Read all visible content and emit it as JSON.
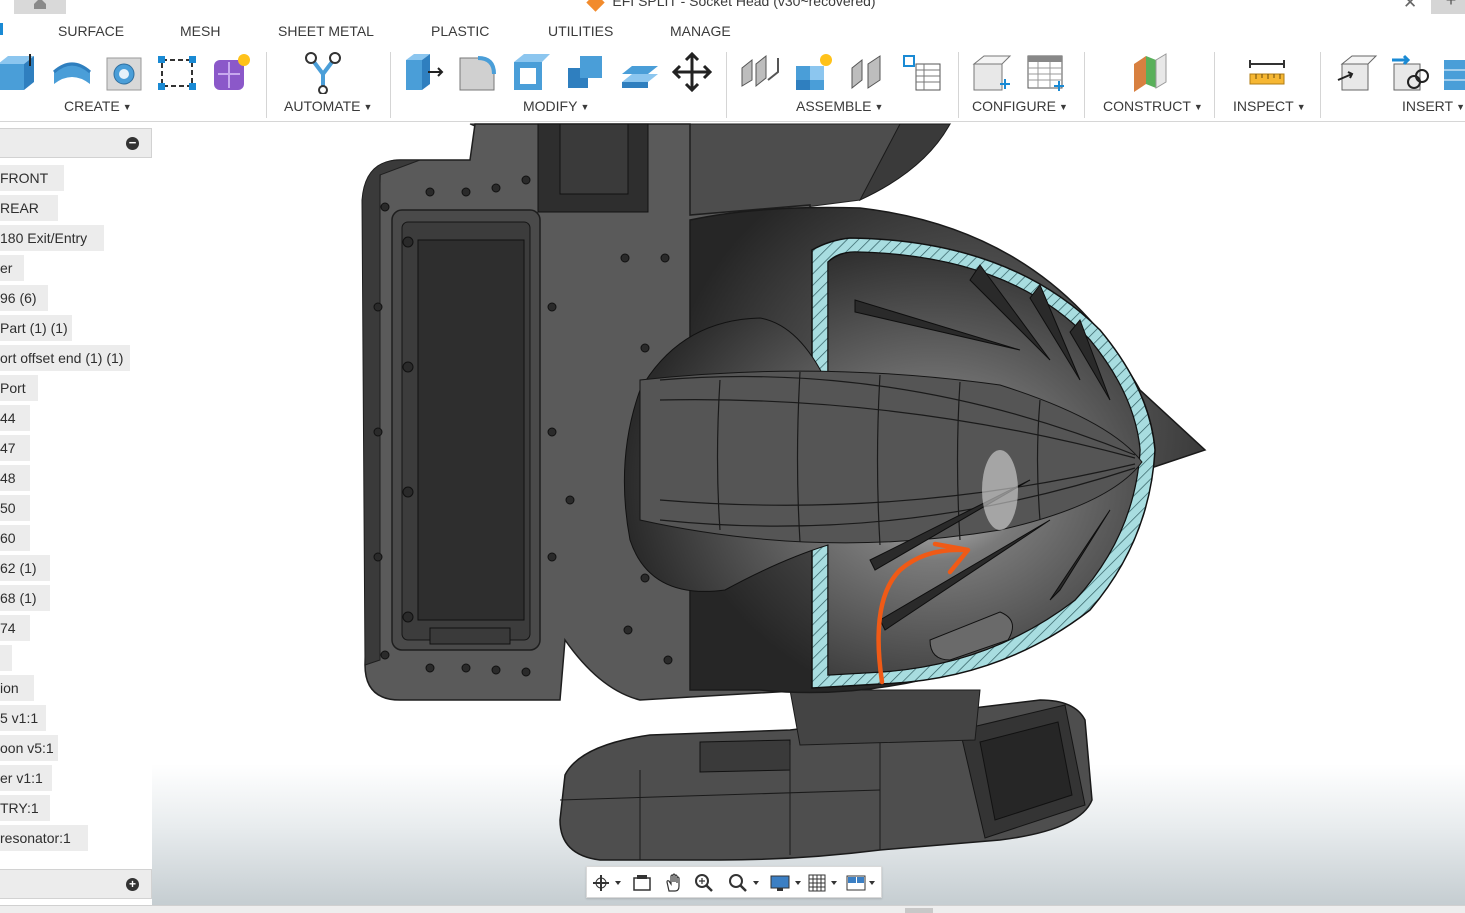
{
  "window": {
    "title": "EFI SPLIT - Socket Head (v30~recovered)"
  },
  "tabs": [
    {
      "label": "SURFACE"
    },
    {
      "label": "MESH"
    },
    {
      "label": "SHEET METAL"
    },
    {
      "label": "PLASTIC"
    },
    {
      "label": "UTILITIES"
    },
    {
      "label": "MANAGE"
    }
  ],
  "ribbon": {
    "groups": [
      {
        "label": "CREATE",
        "icons": [
          "extrude-icon",
          "sweep-icon",
          "hole-icon",
          "sketch-icon",
          "create-form-icon"
        ]
      },
      {
        "label": "AUTOMATE",
        "icons": [
          "automate-icon"
        ]
      },
      {
        "label": "MODIFY",
        "icons": [
          "press-pull-icon",
          "fillet-icon",
          "shell-icon",
          "combine-icon",
          "offset-face-icon",
          "move-icon"
        ]
      },
      {
        "label": "ASSEMBLE",
        "icons": [
          "joint-icon",
          "new-component-icon",
          "as-built-joint-icon",
          "table-icon"
        ]
      },
      {
        "label": "CONFIGURE",
        "icons": [
          "configure-icon",
          "configuration-table-icon"
        ]
      },
      {
        "label": "CONSTRUCT",
        "icons": [
          "plane-icon"
        ]
      },
      {
        "label": "INSPECT",
        "icons": [
          "measure-icon"
        ]
      },
      {
        "label": "INSERT",
        "icons": [
          "insert-derive-icon",
          "insert-link-icon",
          "insert-mesh-icon"
        ]
      }
    ]
  },
  "browser": {
    "items": [
      " FRONT",
      " REAR",
      " 180 Exit/Entry",
      "er",
      "96 (6)",
      "Part (1) (1)",
      "ort offset end (1) (1)",
      " Port",
      "44",
      "47",
      "48",
      "50",
      "60",
      "62 (1)",
      "68 (1)",
      "74",
      "",
      "ion",
      "5 v1:1",
      "oon v5:1",
      "er v1:1",
      "TRY:1",
      " resonator:1"
    ]
  },
  "colors": {
    "section_fill": "#a8dde0",
    "annotation_arrow": "#f05a16",
    "part_body": "#4a4a4a",
    "accent": "#1a8ad4"
  },
  "navbar": {
    "icons": [
      "orbit-icon",
      "look-at-icon",
      "pan-icon",
      "zoom-icon",
      "fit-icon",
      "display-settings-icon",
      "grid-icon",
      "viewports-icon"
    ]
  }
}
